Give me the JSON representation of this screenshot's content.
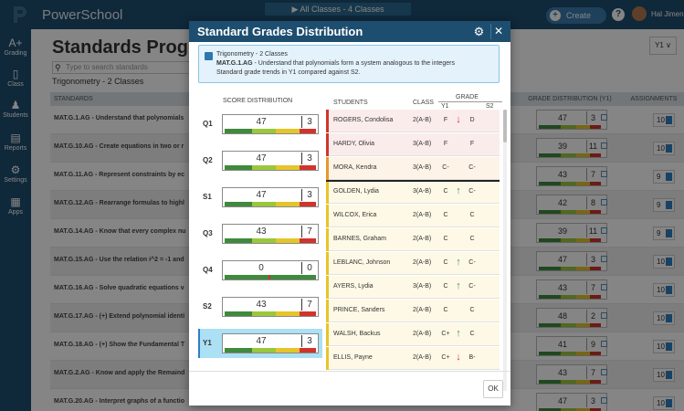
{
  "topbar": {
    "brand": "PowerSchool",
    "classes_label": "▶  All Classes - 4 Classes",
    "create_label": "Create",
    "help_label": "?",
    "user_name": "Hal Jimene"
  },
  "sidenav": {
    "items": [
      {
        "label": "Grading",
        "icon": "A+"
      },
      {
        "label": "Class",
        "icon": "▯"
      },
      {
        "label": "Students",
        "icon": "♟"
      },
      {
        "label": "Reports",
        "icon": "▤"
      },
      {
        "label": "Settings",
        "icon": "⚙"
      },
      {
        "label": "Apps",
        "icon": "▦"
      }
    ]
  },
  "main": {
    "title": "Standards Progress",
    "search_placeholder": "Type to search standards",
    "subtitle": "Trigonometry - 2 Classes",
    "term": "Y1 ∨",
    "columns": {
      "standards": "STANDARDS",
      "grade_distribution": "GRADE DISTRIBUTION (Y1)",
      "assignments": "ASSIGNMENTS"
    },
    "rows": [
      {
        "text": "MAT.G.1.AG - Understand that polynomials",
        "dist_a": "47",
        "dist_b": "3",
        "assignments": "10"
      },
      {
        "text": "MAT.G.10.AG - Create equations in two or r",
        "dist_a": "39",
        "dist_b": "11",
        "assignments": "10"
      },
      {
        "text": "MAT.G.11.AG - Represent constraints by ec",
        "dist_a": "43",
        "dist_b": "7",
        "assignments": "9"
      },
      {
        "text": "MAT.G.12.AG - Rearrange formulas to highl",
        "dist_a": "42",
        "dist_b": "8",
        "assignments": "9"
      },
      {
        "text": "MAT.G.14.AG - Know that every complex nu",
        "dist_a": "39",
        "dist_b": "11",
        "assignments": "9"
      },
      {
        "text": "MAT.G.15.AG - Use the relation i^2 = -1 and",
        "dist_a": "47",
        "dist_b": "3",
        "assignments": "10"
      },
      {
        "text": "MAT.G.16.AG - Solve quadratic equations v",
        "dist_a": "43",
        "dist_b": "7",
        "assignments": "10"
      },
      {
        "text": "MAT.G.17.AG - (+) Extend polynomial identi",
        "dist_a": "48",
        "dist_b": "2",
        "assignments": "10"
      },
      {
        "text": "MAT.G.18.AG - (+) Show the Fundamental T",
        "dist_a": "41",
        "dist_b": "9",
        "assignments": "10"
      },
      {
        "text": "MAT.G.2.AG - Know and apply the Remaind",
        "dist_a": "43",
        "dist_b": "7",
        "assignments": "10"
      },
      {
        "text": "MAT.G.20.AG - Interpret graphs of a functio",
        "dist_a": "47",
        "dist_b": "3",
        "assignments": "10"
      }
    ]
  },
  "modal": {
    "title": "Standard Grades Distribution",
    "info": {
      "line1": "Trigonometry - 2 Classes",
      "line2_code": "MAT.G.1.AG",
      "line2_text": " - Understand that polynomials form a system analogous to the integers",
      "line3": "Standard grade trends in Y1 compared against S2."
    },
    "headers": {
      "score_distribution": "SCORE DISTRIBUTION",
      "students": "STUDENTS",
      "class": "CLASS",
      "grade": "GRADE",
      "y1": "Y1",
      "s2": "S2"
    },
    "score_rows": [
      {
        "label": "Q1",
        "a": "47",
        "b": "3",
        "selected": false
      },
      {
        "label": "Q2",
        "a": "47",
        "b": "3",
        "selected": false
      },
      {
        "label": "S1",
        "a": "47",
        "b": "3",
        "selected": false
      },
      {
        "label": "Q3",
        "a": "43",
        "b": "7",
        "selected": false
      },
      {
        "label": "Q4",
        "a": "0",
        "b": "0",
        "selected": false
      },
      {
        "label": "S2",
        "a": "43",
        "b": "7",
        "selected": false
      },
      {
        "label": "Y1",
        "a": "47",
        "b": "3",
        "selected": true
      }
    ],
    "students": [
      {
        "name": "ROGERS, Condolisa",
        "class": "2(A-B)",
        "y1": "F",
        "trend": "down",
        "s2": "D",
        "flag": "#d0342c",
        "bg": "#fbecec"
      },
      {
        "name": "HARDY, Olivia",
        "class": "3(A-B)",
        "y1": "F",
        "trend": "",
        "s2": "F",
        "flag": "#d0342c",
        "bg": "#fbecec"
      },
      {
        "name": "MORA, Kendra",
        "class": "3(A-B)",
        "y1": "C-",
        "trend": "",
        "s2": "C-",
        "flag": "#e59a2a",
        "bg": "#fdf3e6"
      },
      {
        "name": "GOLDEN, Lydia",
        "class": "3(A-B)",
        "y1": "C",
        "trend": "up",
        "s2": "C-",
        "flag": "#e5c529",
        "bg": "#fdf9e6"
      },
      {
        "name": "WILCOX, Erica",
        "class": "2(A-B)",
        "y1": "C",
        "trend": "",
        "s2": "C",
        "flag": "#e5c529",
        "bg": "#fdf9e6"
      },
      {
        "name": "BARNES, Graham",
        "class": "2(A-B)",
        "y1": "C",
        "trend": "",
        "s2": "C",
        "flag": "#e5c529",
        "bg": "#fdf9e6"
      },
      {
        "name": "LEBLANC, Johnson",
        "class": "2(A-B)",
        "y1": "C",
        "trend": "up",
        "s2": "C-",
        "flag": "#e5c529",
        "bg": "#fdf9e6"
      },
      {
        "name": "AYERS, Lydia",
        "class": "3(A-B)",
        "y1": "C",
        "trend": "up",
        "s2": "C-",
        "flag": "#e5c529",
        "bg": "#fdf9e6"
      },
      {
        "name": "PRINCE, Sanders",
        "class": "2(A-B)",
        "y1": "C",
        "trend": "",
        "s2": "C",
        "flag": "#e5c529",
        "bg": "#fdf9e6"
      },
      {
        "name": "WALSH, Backus",
        "class": "2(A-B)",
        "y1": "C+",
        "trend": "up",
        "s2": "C",
        "flag": "#e5c529",
        "bg": "#fdf9e6"
      },
      {
        "name": "ELLIS, Payne",
        "class": "2(A-B)",
        "y1": "C+",
        "trend": "down",
        "s2": "B-",
        "flag": "#e5c529",
        "bg": "#fdf9e6"
      }
    ],
    "ok_label": "OK",
    "colors": {
      "header": "#1e4e6f",
      "up": "#3f9a3c",
      "down": "#d0342c"
    }
  }
}
